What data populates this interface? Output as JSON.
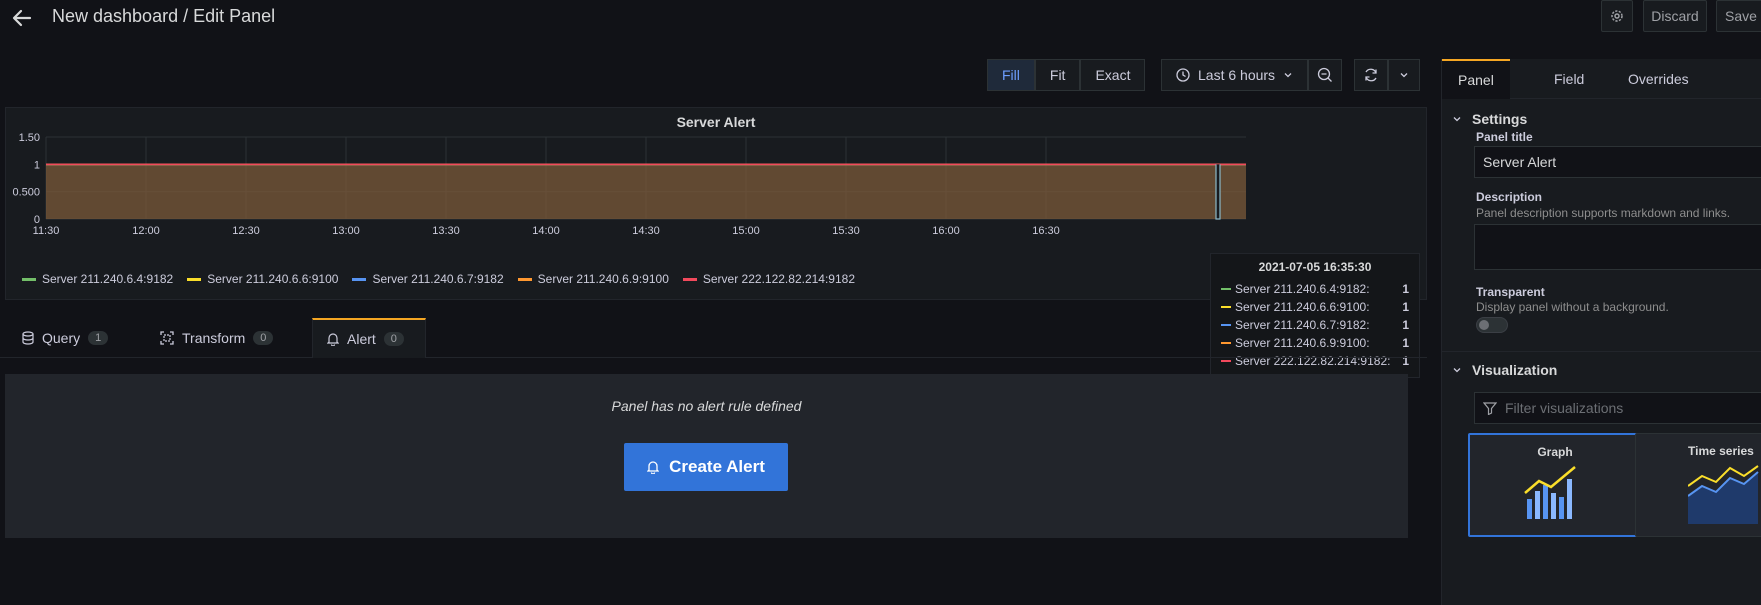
{
  "header": {
    "title": "New dashboard / Edit Panel",
    "discard_label": "Discard",
    "save_label": "Save"
  },
  "toolbar": {
    "fill_label": "Fill",
    "fit_label": "Fit",
    "exact_label": "Exact",
    "time_range": "Last 6 hours"
  },
  "chart_data": {
    "type": "area",
    "title": "Server Alert",
    "x_ticks": [
      "11:30",
      "12:00",
      "12:30",
      "13:00",
      "13:30",
      "14:00",
      "14:30",
      "15:00",
      "15:30",
      "16:00",
      "16:30"
    ],
    "y_ticks": [
      "0",
      "0.500",
      "1",
      "1.50"
    ],
    "ylim": [
      0,
      1.5
    ],
    "series": [
      {
        "name": "Server 211.240.6.4:9182",
        "color": "#73bf69",
        "value": 1
      },
      {
        "name": "Server 211.240.6.6:9100",
        "color": "#fade2a",
        "value": 1
      },
      {
        "name": "Server 211.240.6.7:9182",
        "color": "#5794f2",
        "value": 1
      },
      {
        "name": "Server 211.240.6.9:9100",
        "color": "#ff9830",
        "value": 1
      },
      {
        "name": "Server 222.122.82.214:9182",
        "color": "#f2495c",
        "value": 1
      }
    ],
    "legend_placement": "bottom",
    "grid": true
  },
  "tooltip": {
    "time": "2021-07-05 16:35:30",
    "rows": [
      {
        "name": "Server 211.240.6.4:9182:",
        "value": "1"
      },
      {
        "name": "Server 211.240.6.6:9100:",
        "value": "1"
      },
      {
        "name": "Server 211.240.6.7:9182:",
        "value": "1"
      },
      {
        "name": "Server 211.240.6.9:9100:",
        "value": "1"
      },
      {
        "name": "Server 222.122.82.214:9182:",
        "value": "1"
      }
    ]
  },
  "editor_tabs": [
    {
      "label": "Query",
      "count": "1"
    },
    {
      "label": "Transform",
      "count": "0"
    },
    {
      "label": "Alert",
      "count": "0"
    }
  ],
  "alert": {
    "message": "Panel has no alert rule defined",
    "button": "Create Alert"
  },
  "options": {
    "tabs": [
      "Panel",
      "Field",
      "Overrides"
    ],
    "settings_title": "Settings",
    "panel_title_label": "Panel title",
    "panel_title_value": "Server Alert",
    "description_label": "Description",
    "description_hint": "Panel description supports markdown and links.",
    "transparent_label": "Transparent",
    "transparent_hint": "Display panel without a background.",
    "visualization_title": "Visualization",
    "filter_placeholder": "Filter visualizations",
    "viz": [
      {
        "name": "Graph"
      },
      {
        "name": "Time series"
      }
    ]
  }
}
